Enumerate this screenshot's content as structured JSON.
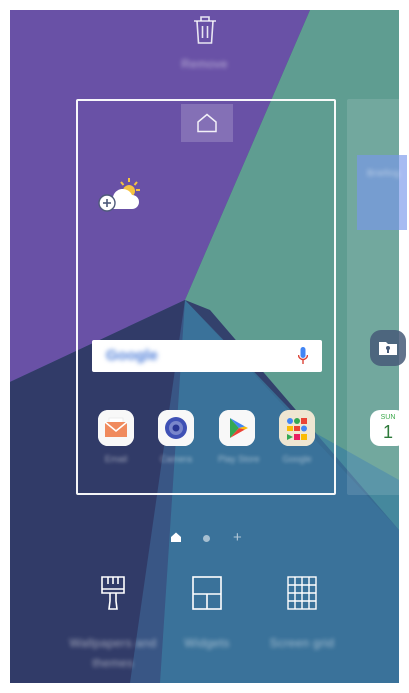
{
  "remove": {
    "label": "Remove",
    "icon": "trash-icon"
  },
  "home_page": {
    "home_icon": "home-icon",
    "weather_icon": "weather-add-icon",
    "search_logo": "Google",
    "apps": [
      {
        "label": "Email",
        "icon": "email-icon"
      },
      {
        "label": "Camera",
        "icon": "camera-icon"
      },
      {
        "label": "Play Store",
        "icon": "play-store-icon"
      },
      {
        "label": "Google",
        "icon": "google-folder-icon"
      }
    ]
  },
  "next_page": {
    "widget_text": "Briefing",
    "calendar": {
      "weekday": "SUN",
      "day": "1"
    }
  },
  "pager": {
    "plus": "+"
  },
  "tools": [
    {
      "label": "Wallpapers and themes",
      "icon": "paintbrush-icon"
    },
    {
      "label": "Widgets",
      "icon": "widgets-icon"
    },
    {
      "label": "Screen grid",
      "icon": "grid-icon"
    }
  ],
  "colors": {
    "wallpaper_purple": "#6b4fa6",
    "wallpaper_teal": "#5e9c90",
    "wallpaper_navy": "#2f3d66"
  }
}
